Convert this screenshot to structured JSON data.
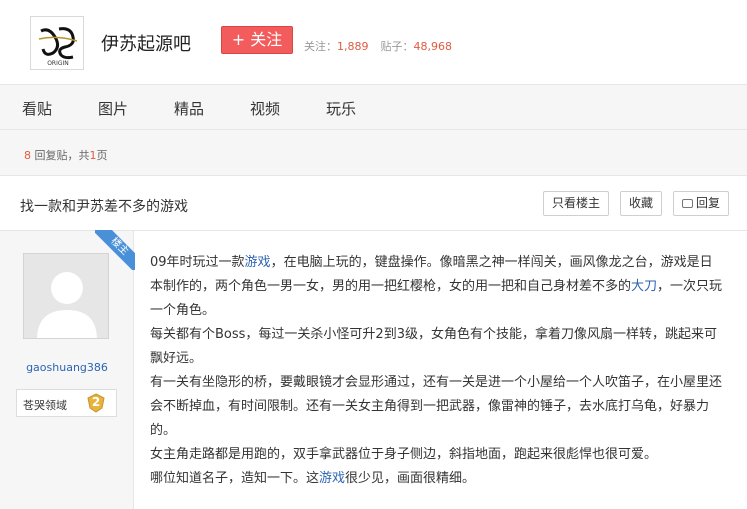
{
  "forum": {
    "name": "伊苏起源吧",
    "follow_label": "+ 关注",
    "followers_label": "关注：",
    "followers_count": "1,889",
    "posts_label": "贴子：",
    "posts_count": "48,968",
    "logo_text": "ORIGIN"
  },
  "nav": {
    "items": [
      {
        "label": "看贴"
      },
      {
        "label": "图片"
      },
      {
        "label": "精品"
      },
      {
        "label": "视频"
      },
      {
        "label": "玩乐"
      }
    ]
  },
  "replybar": {
    "count": "8",
    "text_mid": " 回复贴，共",
    "pages": "1",
    "text_end": "页"
  },
  "thread": {
    "title": "找一款和尹苏差不多的游戏",
    "btn_author_only": "只看楼主",
    "btn_favorite": "收藏",
    "btn_reply": "回复"
  },
  "post": {
    "badge": "楼主",
    "username": "gaoshuang386",
    "level_name": "苍哭领域",
    "level_num": "2",
    "segments": {
      "p1a": "09年时玩过一款",
      "p1kw": "游戏",
      "p1b": "，在电脑上玩的，键盘操作。像暗黑之神一样闯关，画风像龙之台，游戏是日本制作的，两个角色一男一女，男的用一把红樱枪，女的用一把和自己身材差不多的",
      "p1kw2": "大刀",
      "p1c": "，一次只玩一个角色。",
      "p2": "每关都有个Boss，每过一关杀小怪可升2到3级，女角色有个技能，拿着刀像风扇一样转，跳起来可飘好远。",
      "p3": "有一关有坐隐形的桥，要戴眼镜才会显形通过，还有一关是进一个小屋给一个人吹笛子，在小屋里还会不断掉血，有时间限制。还有一关女主角得到一把武器，像雷神的锤子，去水底打乌龟，好暴力的。",
      "p4": "女主角走路都是用跑的，双手拿武器位于身子侧边，斜指地面，跑起来很彪悍也很可爱。",
      "p5a": "哪位知道名子，造知一下。这",
      "p5kw": "游戏",
      "p5b": "很少见，画面很精细。"
    }
  },
  "colors": {
    "accent_red": "#f35c5c",
    "link_blue": "#2d64b3",
    "number_orange": "#e05a40",
    "badge_blue": "#4a90d9",
    "panel_gray": "#f6f6f6"
  }
}
